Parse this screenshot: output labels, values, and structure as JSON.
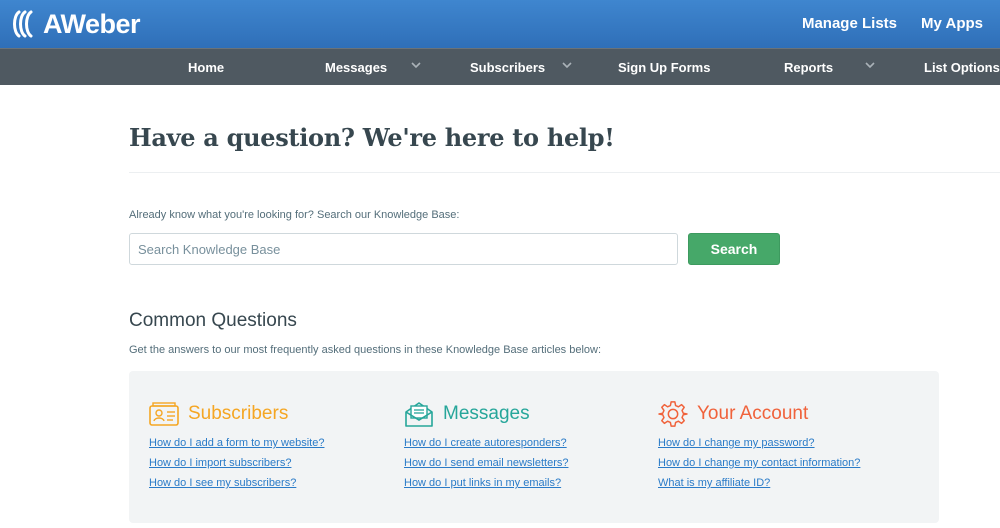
{
  "header": {
    "logo_text": "AWeber",
    "manage_lists": "Manage Lists",
    "my_apps": "My Apps"
  },
  "nav": {
    "items": [
      {
        "label": "Home"
      },
      {
        "label": "Messages"
      },
      {
        "label": "Subscribers"
      },
      {
        "label": "Sign Up Forms"
      },
      {
        "label": "Reports"
      },
      {
        "label": "List Options"
      }
    ]
  },
  "main": {
    "title": "Have a question? We're here to help!",
    "kb_label": "Already know what you're looking for? Search our Knowledge Base:",
    "search": {
      "placeholder": "Search Knowledge Base",
      "value": "",
      "button": "Search"
    },
    "common_title": "Common Questions",
    "common_sub": "Get the answers to our most frequently asked questions in these Knowledge Base articles below:"
  },
  "categories": [
    {
      "title": "Subscribers",
      "icon": "subscribers-icon",
      "color": "#f5a623",
      "links": [
        "How do I add a form to my website?",
        "How do I import subscribers?",
        "How do I see my subscribers?"
      ]
    },
    {
      "title": "Messages",
      "icon": "messages-icon",
      "color": "#26a69a",
      "links": [
        "How do I create autoresponders?",
        "How do I send email newsletters?",
        "How do I put links in my emails?"
      ]
    },
    {
      "title": "Your Account",
      "icon": "gear-icon",
      "color": "#f0623b",
      "links": [
        "How do I change my password?",
        "How do I change my contact information?",
        "What is my affiliate ID?"
      ]
    }
  ],
  "colors": {
    "header_blue": "#2f6fb8",
    "nav_gray": "#4f5961",
    "search_green": "#46a869",
    "link_blue": "#2a7bc8"
  }
}
